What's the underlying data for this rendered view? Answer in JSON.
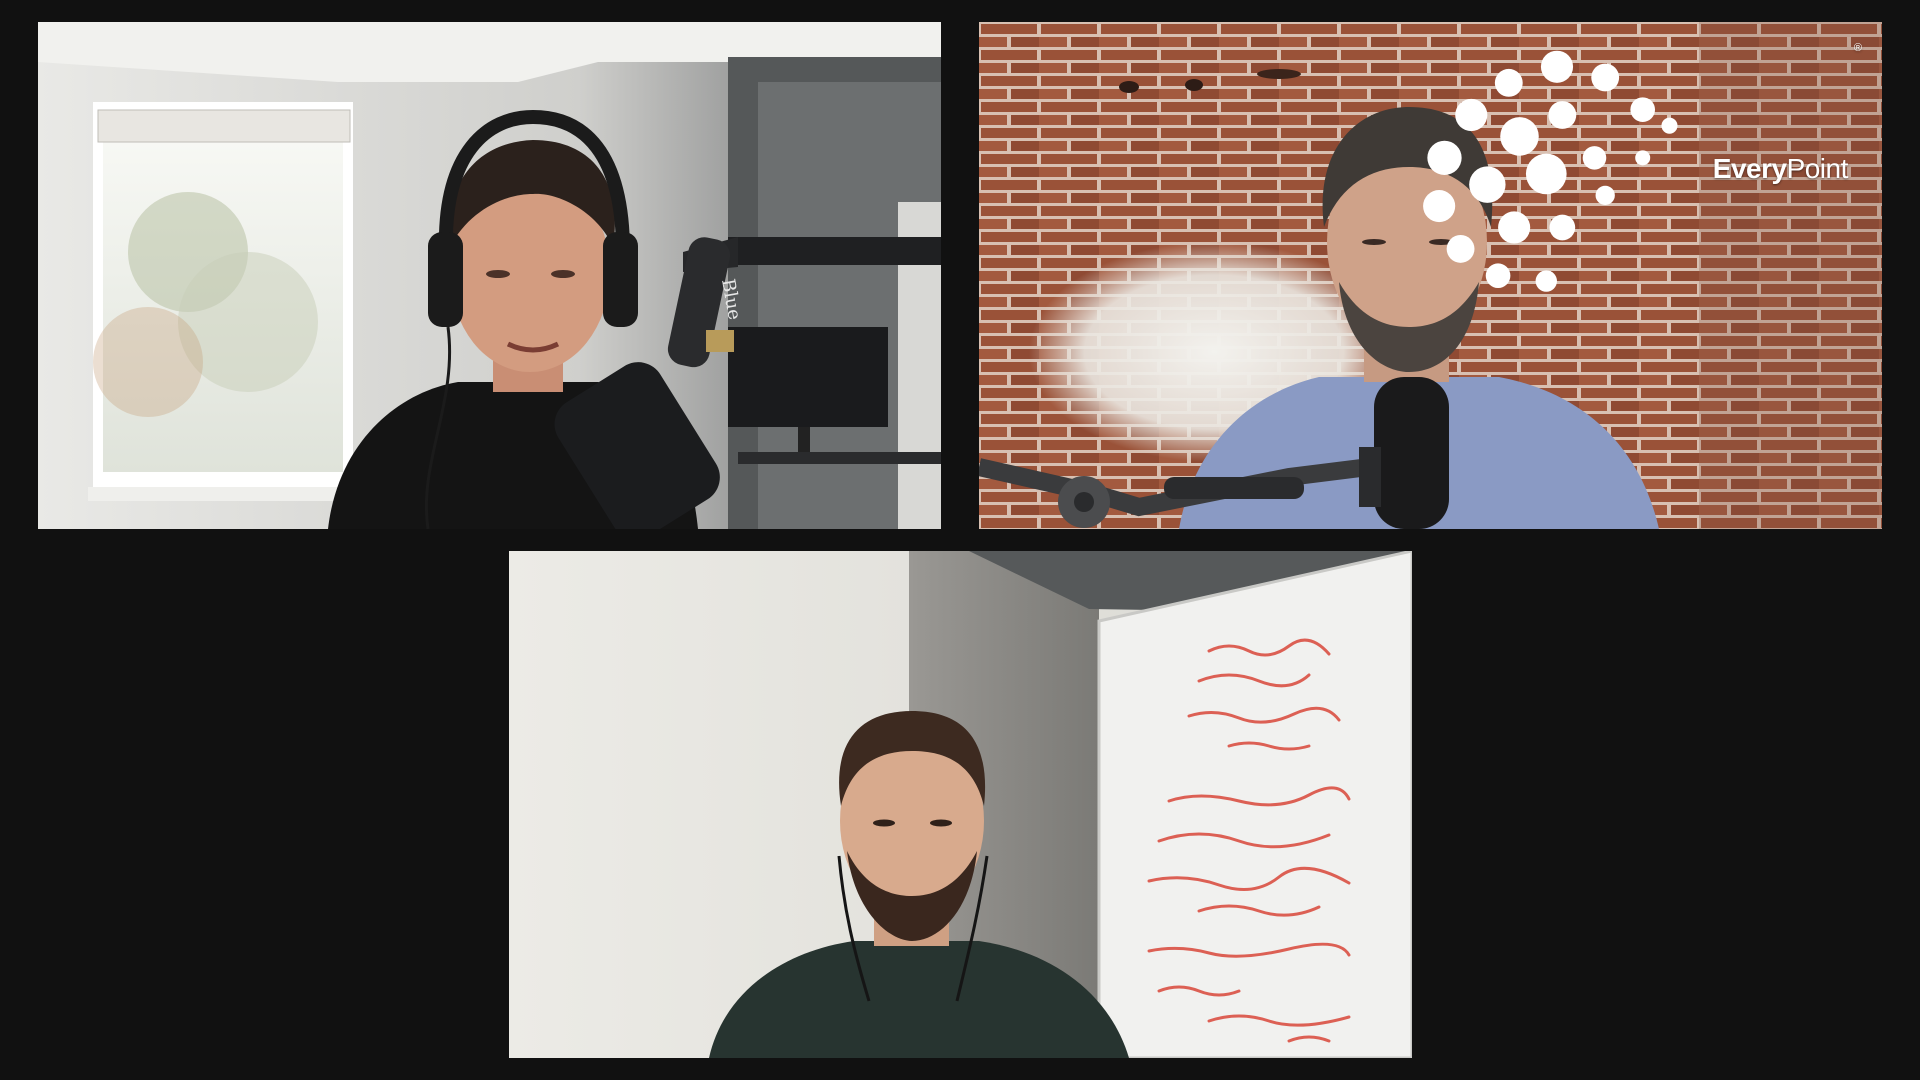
{
  "app": {
    "brand": {
      "name_bold": "Every",
      "name_light": "Point",
      "registered_mark": "®",
      "icon": "everypoint-logo-icon"
    }
  },
  "participants": [
    {
      "tile": "participant-tile-1",
      "scene": "bright room with window, headphones, boom microphone, desk monitor",
      "mic_brand_text": "Blue",
      "colors": {
        "wall": "#d9d9d6",
        "shirt": "#141414"
      }
    },
    {
      "tile": "participant-tile-2",
      "scene": "red brick wall, checked shirt, dark boom microphone",
      "colors": {
        "brick": "#9a5238",
        "shirt": "#8a9ac4"
      }
    },
    {
      "tile": "participant-tile-3",
      "scene": "white wall, concrete pillar, whiteboard with red equations, earphones",
      "colors": {
        "wall": "#e4e3de",
        "pillar": "#8b8a86",
        "whiteboard": "#f1f1ef",
        "ink": "#d9473a"
      }
    }
  ],
  "theme": {
    "background": "#111111"
  }
}
